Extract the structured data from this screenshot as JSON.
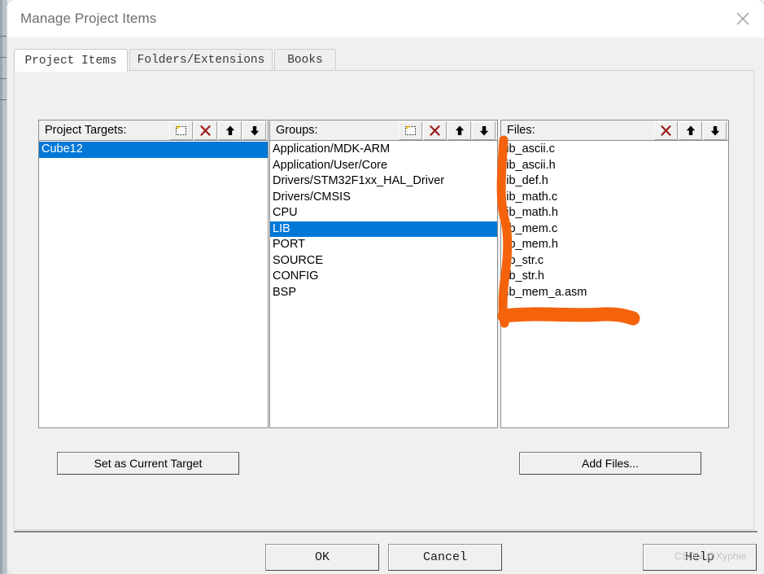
{
  "window": {
    "title": "Manage Project Items",
    "close_icon": "close-icon"
  },
  "tabs": [
    {
      "label": "Project Items",
      "active": true
    },
    {
      "label": "Folders/Extensions",
      "active": false
    },
    {
      "label": "Books",
      "active": false
    }
  ],
  "panels": {
    "targets": {
      "label": "Project Targets:",
      "tools": [
        "new-item-icon",
        "delete-icon",
        "move-up-icon",
        "move-down-icon"
      ],
      "items": [
        {
          "label": "Cube12",
          "selected": true
        }
      ]
    },
    "groups": {
      "label": "Groups:",
      "tools": [
        "new-item-icon",
        "delete-icon",
        "move-up-icon",
        "move-down-icon"
      ],
      "items": [
        {
          "label": "Application/MDK-ARM",
          "selected": false
        },
        {
          "label": "Application/User/Core",
          "selected": false
        },
        {
          "label": "Drivers/STM32F1xx_HAL_Driver",
          "selected": false
        },
        {
          "label": "Drivers/CMSIS",
          "selected": false
        },
        {
          "label": "CPU",
          "selected": false
        },
        {
          "label": "LIB",
          "selected": true
        },
        {
          "label": "PORT",
          "selected": false
        },
        {
          "label": "SOURCE",
          "selected": false
        },
        {
          "label": "CONFIG",
          "selected": false
        },
        {
          "label": "BSP",
          "selected": false
        }
      ]
    },
    "files": {
      "label": "Files:",
      "tools": [
        "delete-icon",
        "move-up-icon",
        "move-down-icon"
      ],
      "items": [
        {
          "label": "lib_ascii.c",
          "selected": false
        },
        {
          "label": "lib_ascii.h",
          "selected": false
        },
        {
          "label": "lib_def.h",
          "selected": false
        },
        {
          "label": "lib_math.c",
          "selected": false
        },
        {
          "label": "lib_math.h",
          "selected": false
        },
        {
          "label": "lib_mem.c",
          "selected": false
        },
        {
          "label": "lib_mem.h",
          "selected": false
        },
        {
          "label": "lib_str.c",
          "selected": false
        },
        {
          "label": "lib_str.h",
          "selected": false
        },
        {
          "label": "lib_mem_a.asm",
          "selected": false
        }
      ]
    }
  },
  "buttons": {
    "set_current_target": "Set as Current Target",
    "add_files": "Add Files...",
    "ok": "OK",
    "cancel": "Cancel",
    "help": "Help"
  },
  "watermark": "CSDN @Xyphie",
  "colors": {
    "selection_blue": "#0078d7",
    "annotation_orange": "#f4630c",
    "dialog_face": "#f0f0f0",
    "delete_red": "#9c1b1b"
  }
}
